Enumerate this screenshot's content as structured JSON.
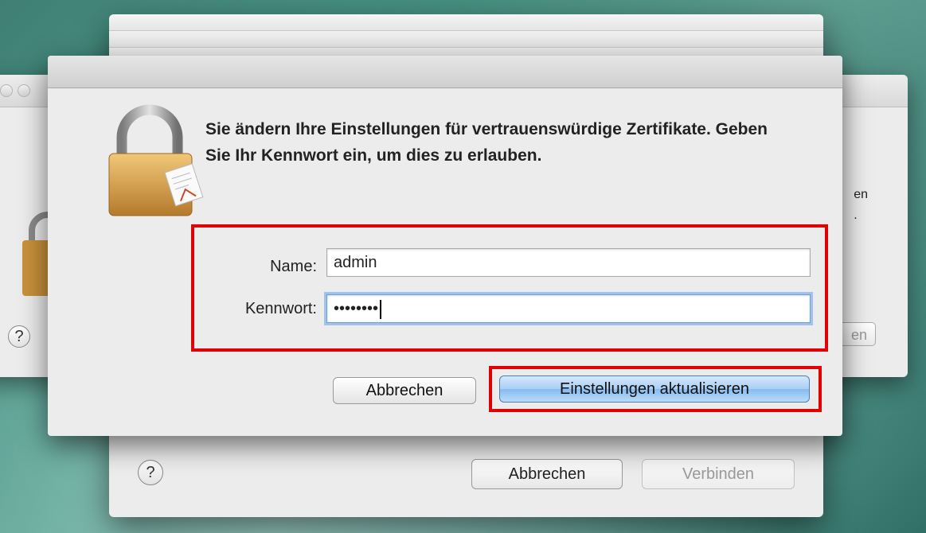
{
  "background_windows": {
    "back": {
      "partial_text_lines": [
        "en",
        "."
      ],
      "button_partial": "en",
      "help_label": "?"
    },
    "middle": {
      "help_label": "?",
      "cancel_label": "Abbrechen",
      "connect_label": "Verbinden"
    }
  },
  "dialog": {
    "message": "Sie ändern Ihre Einstellungen für vertrauenswürdige Zertifikate. Geben Sie Ihr Kennwort ein, um dies zu erlauben.",
    "icon": "lock-certificate-icon",
    "name_label": "Name:",
    "name_value": "admin",
    "password_label": "Kennwort:",
    "password_value": "••••••••",
    "cancel_label": "Abbrechen",
    "confirm_label": "Einstellungen aktualisieren"
  },
  "colors": {
    "highlight": "#e00000",
    "primary_button": "#86bbf0"
  }
}
